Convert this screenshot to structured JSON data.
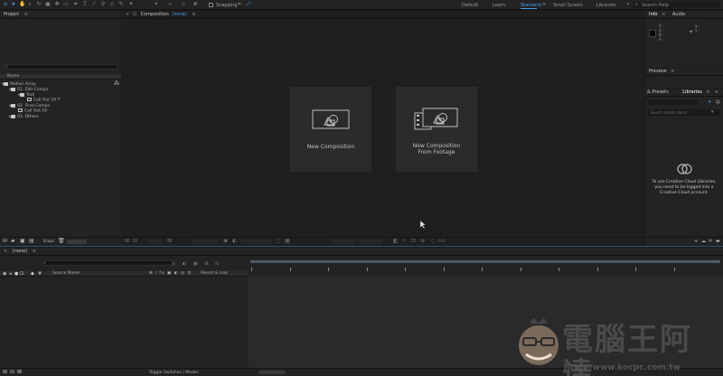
{
  "toolbar": {
    "snapping": "Snapping",
    "workspaces": [
      "Default",
      "Learn",
      "Standard",
      "Small Screen",
      "Libraries"
    ],
    "active_workspace": "Standard",
    "search_placeholder": "Search Help",
    "overflow": "»"
  },
  "project": {
    "title": "Project",
    "column_name": "Name",
    "items": [
      {
        "label": "Motion Array",
        "type": "folder",
        "indent": 0
      },
      {
        "label": "01. Edit Comps",
        "type": "folder",
        "indent": 1
      },
      {
        "label": "Text",
        "type": "folder",
        "indent": 2
      },
      {
        "label": "Call Out 16 T",
        "type": "comp",
        "indent": 3
      },
      {
        "label": "02. Final Comps",
        "type": "folder",
        "indent": 1
      },
      {
        "label": "Call Out 16",
        "type": "comp",
        "indent": 2
      },
      {
        "label": "03. Others",
        "type": "folder",
        "indent": 1
      }
    ],
    "bpc": "8 bpc"
  },
  "composition": {
    "tab_label": "Composition",
    "tab_comp": "(none)",
    "new_comp": "New Composition",
    "new_comp_footage_line1": "New Composition",
    "new_comp_footage_line2": "From Footage",
    "zoom": "0.0"
  },
  "info": {
    "tab_info": "Info",
    "tab_audio": "Audio",
    "channels": [
      "R :",
      "G :",
      "B :",
      "A :"
    ],
    "x_label": "X :",
    "y_label": "Y :"
  },
  "preview": {
    "title": "Preview"
  },
  "libraries": {
    "tab_effects": "& Presets",
    "tab_libraries": "Libraries",
    "search_placeholder": "Search Adobe Stock",
    "message": "To use Creative Cloud Libraries, you need to be logged into a Creative Cloud account."
  },
  "timeline": {
    "tab_label": "(none)",
    "col_source": "Source Name",
    "col_parent": "Parent & Link",
    "toggle": "Toggle Switches / Modes"
  },
  "watermark": {
    "text": "電腦王阿達",
    "url": "http://www.kocpc.com.tw"
  },
  "colors": {
    "accent": "#4b9ce8",
    "bg": "#1d1d1d",
    "panel": "#232323"
  }
}
